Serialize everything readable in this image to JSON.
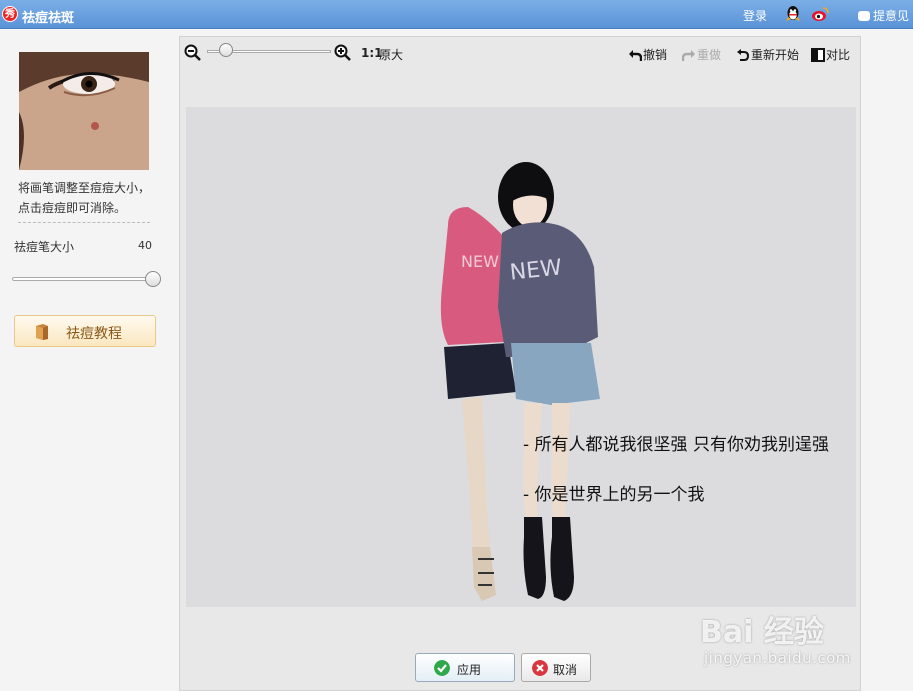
{
  "titlebar": {
    "logo_text": "秀",
    "title": "祛痘祛斑",
    "login": "登录",
    "feedback": "提意见"
  },
  "sidebar": {
    "description_line1": "将画笔调整至痘痘大小，",
    "description_line2": "点击痘痘即可消除。",
    "brush_size_label": "祛痘笔大小",
    "brush_size_value": "40",
    "brush_size_level": 1.0,
    "tutorial_label": "祛痘教程"
  },
  "toolbar": {
    "zoom_level": 0.12,
    "ratio_label": "1:1",
    "original_label": "原大",
    "undo": "撤销",
    "redo": "重做",
    "restart": "重新开始",
    "compare": "对比"
  },
  "canvas": {
    "caption_line1": "- 所有人都说我很坚强 只有你劝我别逞强",
    "caption_line2": "- 你是世界上的另一个我",
    "shirt_text": "NEW"
  },
  "actions": {
    "apply": "应用",
    "cancel": "取消"
  },
  "watermark": {
    "logo": "Bai 经验",
    "url": "jingyan.baidu.com"
  },
  "colors": {
    "titlebar": "#5b93d8",
    "apply_icon": "#2ea84a",
    "cancel_icon": "#d9363e",
    "tutorial_border": "#e9c88a"
  }
}
